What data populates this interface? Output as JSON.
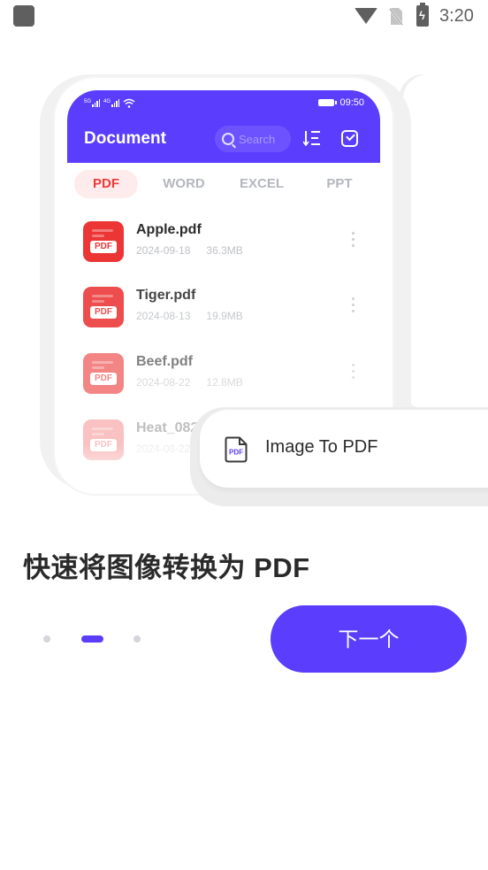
{
  "status_bar": {
    "time": "3:20",
    "icons": [
      "app-notification-icon",
      "wifi-icon",
      "no-sim-icon",
      "battery-charging-icon"
    ]
  },
  "mockup": {
    "status": {
      "signal_1": "5G",
      "signal_2": "4G",
      "time": "09:50"
    },
    "app_title": "Document",
    "search_placeholder": "Search",
    "tabs": [
      {
        "label": "PDF",
        "active": true
      },
      {
        "label": "WORD",
        "active": false
      },
      {
        "label": "EXCEL",
        "active": false
      },
      {
        "label": "PPT",
        "active": false
      }
    ],
    "pdf_tag": "PDF",
    "files": [
      {
        "name": "Apple.pdf",
        "date": "2024-09-18",
        "size": "36.3MB"
      },
      {
        "name": "Tiger.pdf",
        "date": "2024-08-13",
        "size": "19.9MB"
      },
      {
        "name": "Beef.pdf",
        "date": "2024-08-22",
        "size": "12.8MB"
      },
      {
        "name": "Heat_0821",
        "date": "2024-08-22",
        "size": ""
      }
    ],
    "feature_card": {
      "icon_tag": "PDF",
      "label": "Image To PDF"
    }
  },
  "onboarding": {
    "headline": "快速将图像转换为 PDF",
    "pager": {
      "total": 3,
      "current": 2
    },
    "next_button": "下一个"
  },
  "colors": {
    "accent": "#5b3dfd",
    "pdf_red": "#ec3535",
    "tab_active_bg": "#fdeceb"
  }
}
